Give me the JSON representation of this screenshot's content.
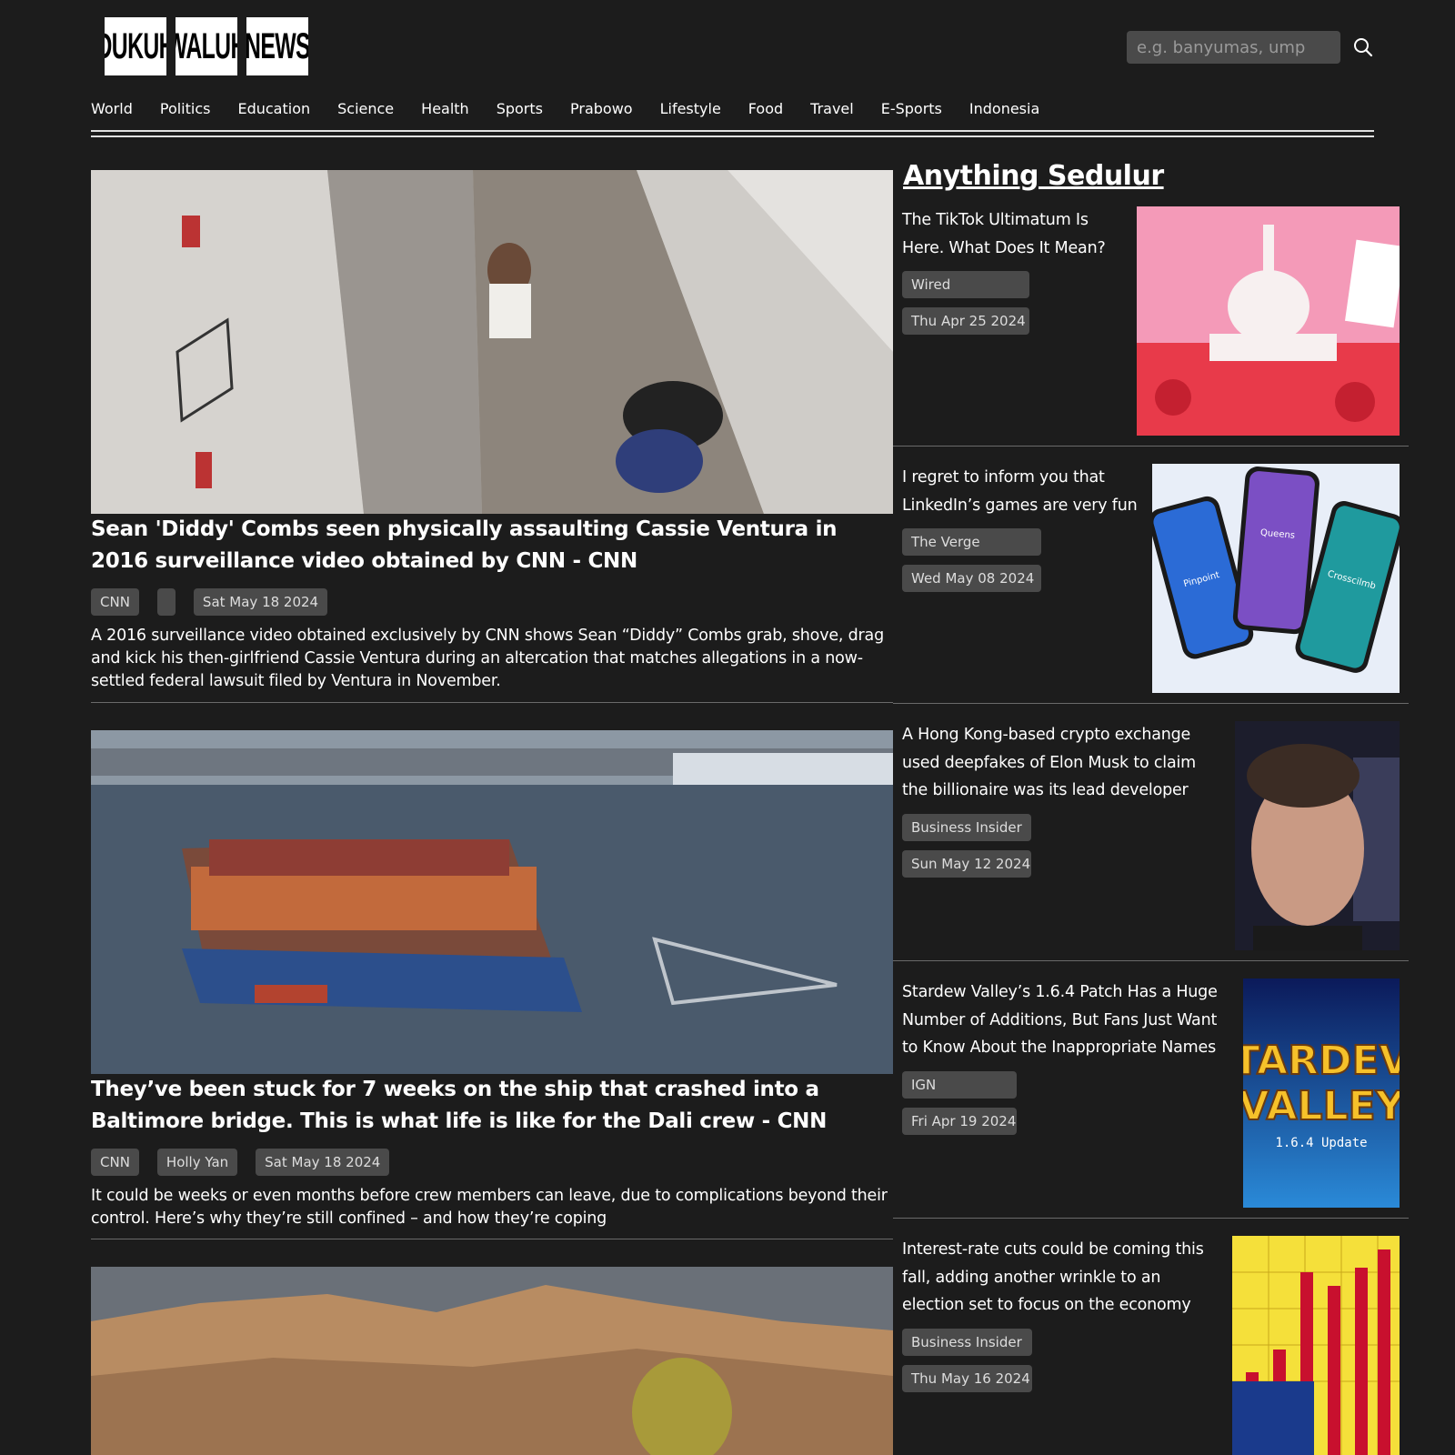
{
  "brand": {
    "logo_parts": [
      "DUKUH",
      "WALUH",
      "NEWS"
    ]
  },
  "search": {
    "placeholder": "e.g. banyumas, ump"
  },
  "nav": [
    "World",
    "Politics",
    "Education",
    "Science",
    "Health",
    "Sports",
    "Prabowo",
    "Lifestyle",
    "Food",
    "Travel",
    "E-Sports",
    "Indonesia"
  ],
  "main_articles": [
    {
      "title": "Sean 'Diddy' Combs seen physically assaulting Cassie Ventura in 2016 surveillance video obtained by CNN - CNN",
      "source": "CNN",
      "author": "",
      "date": "Sat May 18 2024",
      "description": "A 2016 surveillance video obtained exclusively by CNN shows Sean “Diddy” Combs grab, shove, drag and kick his then-girlfriend Cassie Ventura during an altercation that matches allegations in a now-settled federal lawsuit filed by Ventura in November."
    },
    {
      "title": "They’ve been stuck for 7 weeks on the ship that crashed into a Baltimore bridge. This is what life is like for the Dali crew - CNN",
      "source": "CNN",
      "author": "Holly Yan",
      "date": "Sat May 18 2024",
      "description": "It could be weeks or even months before crew members can leave, due to complications beyond their control. Here’s why they’re still confined – and how they’re coping"
    }
  ],
  "sidebar": {
    "heading": "Anything Sedulur",
    "items": [
      {
        "title": "The TikTok Ultimatum Is Here. What Does It Mean?",
        "source": "Wired",
        "date": "Thu Apr 25 2024"
      },
      {
        "title": "I regret to inform you that LinkedIn’s games are very fun",
        "source": "The Verge",
        "date": "Wed May 08 2024"
      },
      {
        "title": "A Hong Kong-based crypto exchange used deepfakes of Elon Musk to claim the billionaire was its lead developer",
        "source": "Business Insider",
        "date": "Sun May 12 2024"
      },
      {
        "title": "Stardew Valley’s 1.6.4 Patch Has a Huge Number of Additions, But Fans Just Want to Know About the Inappropriate Names",
        "source": "IGN",
        "date": "Fri Apr 19 2024"
      },
      {
        "title": "Interest-rate cuts could be coming this fall, adding another wrinkle to an election set to focus on the economy",
        "source": "Business Insider",
        "date": "Thu May 16 2024"
      }
    ]
  },
  "image_text": {
    "phones": [
      "Pinpoint",
      "Queens",
      "Crosscilmb"
    ],
    "stardew": [
      "TARDEV",
      "VALLEY",
      "1.6.4 Update"
    ]
  }
}
